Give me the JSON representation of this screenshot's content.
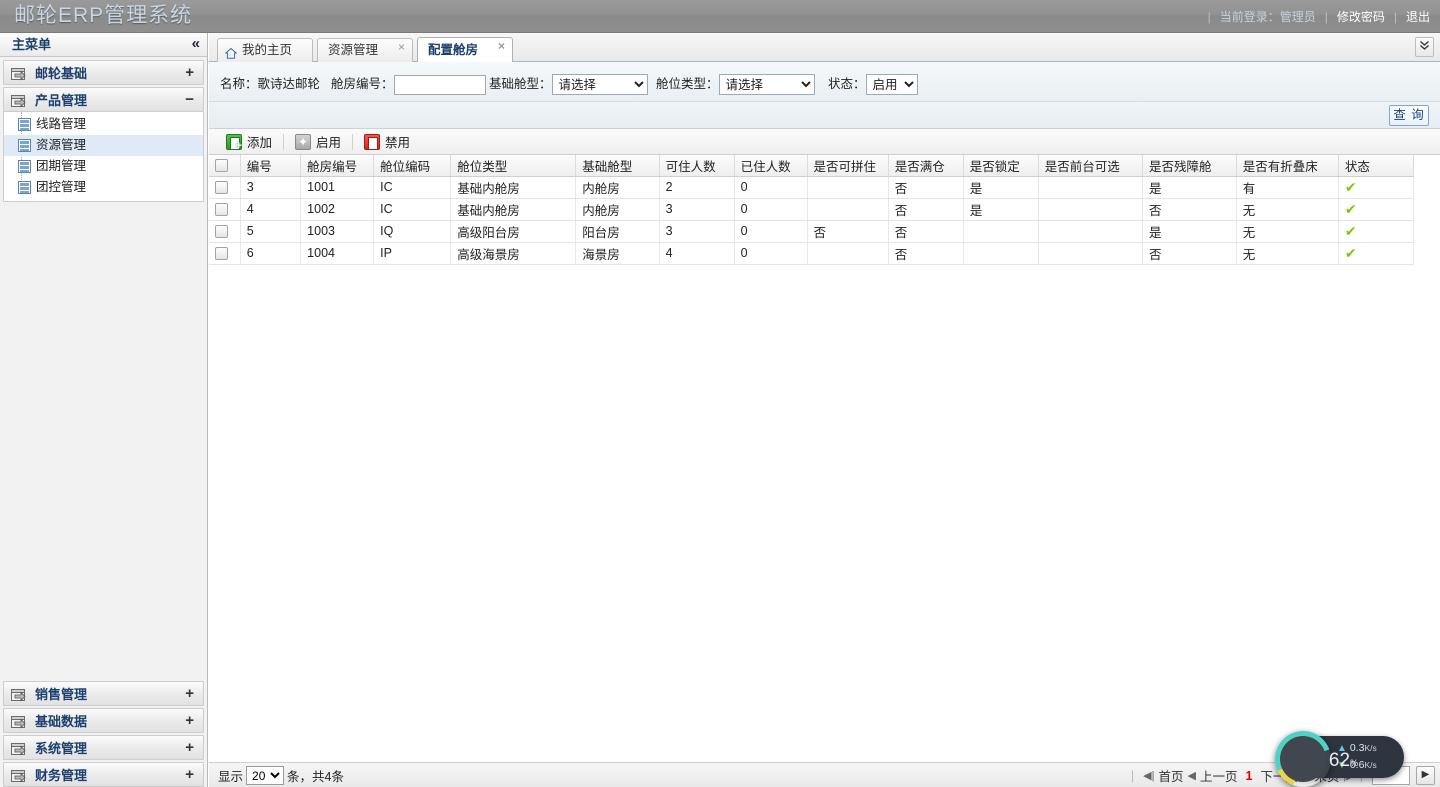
{
  "header": {
    "brand": "邮轮ERP管理系统",
    "login_label": "当前登录：管理员",
    "change_password": "修改密码",
    "logout": "退出",
    "separator": "|"
  },
  "sidebar": {
    "title": "主菜单",
    "collapse_icon": "«",
    "groups": [
      {
        "label": "邮轮基础",
        "toggle": "+",
        "expanded": false,
        "items": []
      },
      {
        "label": "产品管理",
        "toggle": "−",
        "expanded": true,
        "items": [
          {
            "label": "线路管理",
            "active": false
          },
          {
            "label": "资源管理",
            "active": true
          },
          {
            "label": "团期管理",
            "active": false
          },
          {
            "label": "团控管理",
            "active": false
          }
        ]
      },
      {
        "label": "销售管理",
        "toggle": "+",
        "expanded": false,
        "items": []
      },
      {
        "label": "基础数据",
        "toggle": "+",
        "expanded": false,
        "items": []
      },
      {
        "label": "系统管理",
        "toggle": "+",
        "expanded": false,
        "items": []
      },
      {
        "label": "财务管理",
        "toggle": "+",
        "expanded": false,
        "items": []
      }
    ]
  },
  "tabs": {
    "items": [
      {
        "label": "我的主页",
        "closable": false,
        "active": false,
        "icon": "home-icon"
      },
      {
        "label": "资源管理",
        "closable": true,
        "active": false
      },
      {
        "label": "配置舱房",
        "closable": true,
        "active": true
      }
    ],
    "close_glyph": "×",
    "scroll_glyph": "⌄"
  },
  "filters": {
    "name_label": "名称：",
    "name_value": "歌诗达邮轮",
    "room_no_label": "舱房编号：",
    "room_no_value": "",
    "room_no_placeholder": "",
    "base_cabin_label": "基础舱型：",
    "base_cabin_value": "请选择",
    "base_cabin_options": [
      "请选择"
    ],
    "cabin_type_label": "舱位类型：",
    "cabin_type_value": "请选择",
    "cabin_type_options": [
      "请选择"
    ],
    "status_label": "状态：",
    "status_value": "启用",
    "status_options": [
      "启用"
    ],
    "query_button": "查 询"
  },
  "toolbar": {
    "add_label": "添加",
    "enable_label": "启用",
    "disable_label": "禁用"
  },
  "table": {
    "columns": [
      "编号",
      "舱房编号",
      "舱位编码",
      "舱位类型",
      "基础舱型",
      "可住人数",
      "已住人数",
      "是否可拼住",
      "是否满仓",
      "是否锁定",
      "是否前台可选",
      "是否残障舱",
      "是否有折叠床",
      "状态"
    ],
    "rows": [
      {
        "checked": false,
        "cells": [
          "3",
          "1001",
          "IC",
          "基础内舱房",
          "内舱房",
          "2",
          "0",
          "",
          "否",
          "是",
          "",
          "是",
          "有"
        ],
        "status_icon": "✔"
      },
      {
        "checked": false,
        "cells": [
          "4",
          "1002",
          "IC",
          "基础内舱房",
          "内舱房",
          "3",
          "0",
          "",
          "否",
          "是",
          "",
          "否",
          "无"
        ],
        "status_icon": "✔"
      },
      {
        "checked": false,
        "cells": [
          "5",
          "1003",
          "IQ",
          "高级阳台房",
          "阳台房",
          "3",
          "0",
          "否",
          "否",
          "",
          "",
          "是",
          "无"
        ],
        "status_icon": "✔"
      },
      {
        "checked": false,
        "cells": [
          "6",
          "1004",
          "IP",
          "高级海景房",
          "海景房",
          "4",
          "0",
          "",
          "否",
          "",
          "",
          "否",
          "无"
        ],
        "status_icon": "✔"
      }
    ]
  },
  "footer": {
    "show_label": "显示",
    "page_size": "20",
    "page_size_options": [
      "20"
    ],
    "count_label": "条，共4条",
    "first_page": "首页",
    "prev_page": "上一页",
    "current_page": "1",
    "next_page": "下一页",
    "last_page": "末页",
    "page_input_value": "",
    "go_glyph": "▶"
  },
  "monitor": {
    "cpu_percent": "62",
    "percent_unit": "%",
    "upload_rate": "0.3",
    "download_rate": "0.6",
    "rate_unit": "K/s"
  },
  "colors": {
    "topbar": "#909090",
    "brand_text": "#c9d6e5",
    "menu_text": "#1c3f6e",
    "active_item_bg": "#dfeaf6",
    "status_ok": "#7ac70c",
    "current_page": "#e00000",
    "query_border": "#7aaad4"
  }
}
